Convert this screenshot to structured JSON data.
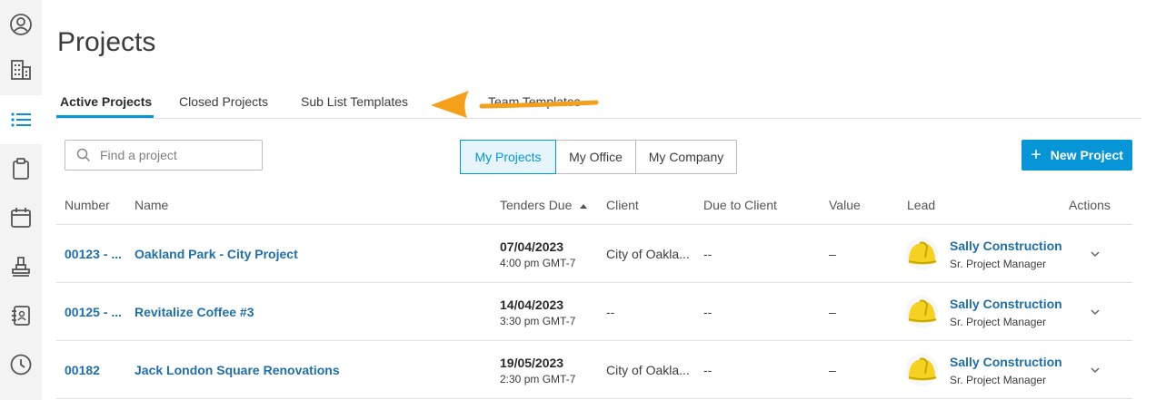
{
  "page": {
    "title": "Projects"
  },
  "sidebar": {
    "icons": [
      "user-circle-icon",
      "building-icon",
      "list-icon",
      "clipboard-icon",
      "calendar-icon",
      "stamp-icon",
      "address-book-icon",
      "clock-icon"
    ],
    "active": "list-icon"
  },
  "tabs": [
    {
      "label": "Active Projects",
      "active": true
    },
    {
      "label": "Closed Projects"
    },
    {
      "label": "Sub List Templates"
    },
    {
      "label": "Team Templates"
    }
  ],
  "search": {
    "placeholder": "Find a project"
  },
  "filters": {
    "options": [
      "My Projects",
      "My Office",
      "My Company"
    ],
    "selected": "My Projects"
  },
  "new_project_label": "New Project",
  "table": {
    "headers": {
      "number": "Number",
      "name": "Name",
      "tenders_due": "Tenders Due",
      "client": "Client",
      "due_to_client": "Due to Client",
      "value": "Value",
      "lead": "Lead",
      "actions": "Actions"
    },
    "rows": [
      {
        "number": "00123 - ...",
        "name": "Oakland Park - City Project",
        "date": "07/04/2023",
        "time": "4:00 pm GMT-7",
        "client": "City of Oakla...",
        "due_to_client": "--",
        "value": "–",
        "lead_name": "Sally Construction",
        "lead_role": "Sr. Project Manager"
      },
      {
        "number": "00125 - ...",
        "name": "Revitalize Coffee #3",
        "date": "14/04/2023",
        "time": "3:30 pm GMT-7",
        "client": "--",
        "due_to_client": "--",
        "value": "–",
        "lead_name": "Sally Construction",
        "lead_role": "Sr. Project Manager"
      },
      {
        "number": "00182",
        "name": "Jack London Square Renovations",
        "date": "19/05/2023",
        "time": "2:30 pm GMT-7",
        "client": "City of Oakla...",
        "due_to_client": "--",
        "value": "–",
        "lead_name": "Sally Construction",
        "lead_role": "Sr. Project Manager"
      }
    ]
  },
  "colors": {
    "accent": "#0696d7",
    "link": "#1f6fa9",
    "annotation_arrow": "#f5a01a"
  }
}
